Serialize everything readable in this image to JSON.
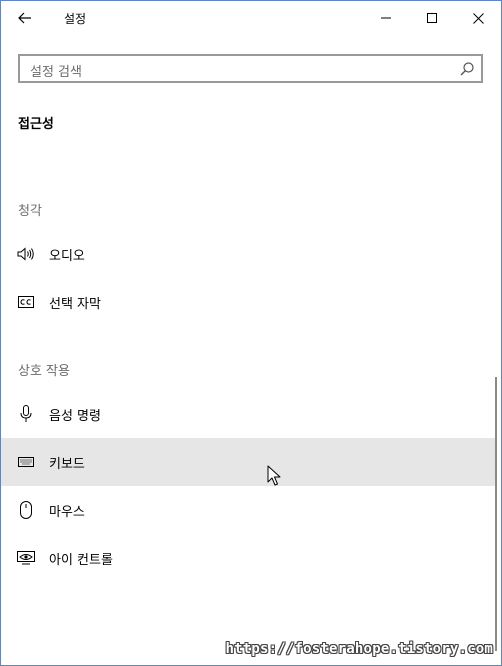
{
  "window": {
    "title": "설정",
    "icons": {
      "back": "back-arrow-icon",
      "minimize": "minimize-icon",
      "maximize": "maximize-icon",
      "close": "close-icon"
    }
  },
  "search": {
    "placeholder": "설정 검색",
    "icon": "search-icon"
  },
  "page": {
    "title": "접근성"
  },
  "groups": [
    {
      "header": "청각",
      "items": [
        {
          "label": "오디오",
          "icon": "speaker-icon"
        },
        {
          "label": "선택 자막",
          "icon": "closed-caption-icon"
        }
      ]
    },
    {
      "header": "상호 작용",
      "items": [
        {
          "label": "음성 명령",
          "icon": "microphone-icon"
        },
        {
          "label": "키보드",
          "icon": "keyboard-icon",
          "hovered": true
        },
        {
          "label": "마우스",
          "icon": "mouse-icon"
        },
        {
          "label": "아이 컨트롤",
          "icon": "eye-control-icon"
        }
      ]
    }
  ],
  "watermark": "https://fosterahope.tistory.com",
  "colors": {
    "window_border": "#5f86c6",
    "hover_background": "#e6e6e6",
    "muted_text": "#6d6d6d",
    "search_border": "#999999"
  }
}
